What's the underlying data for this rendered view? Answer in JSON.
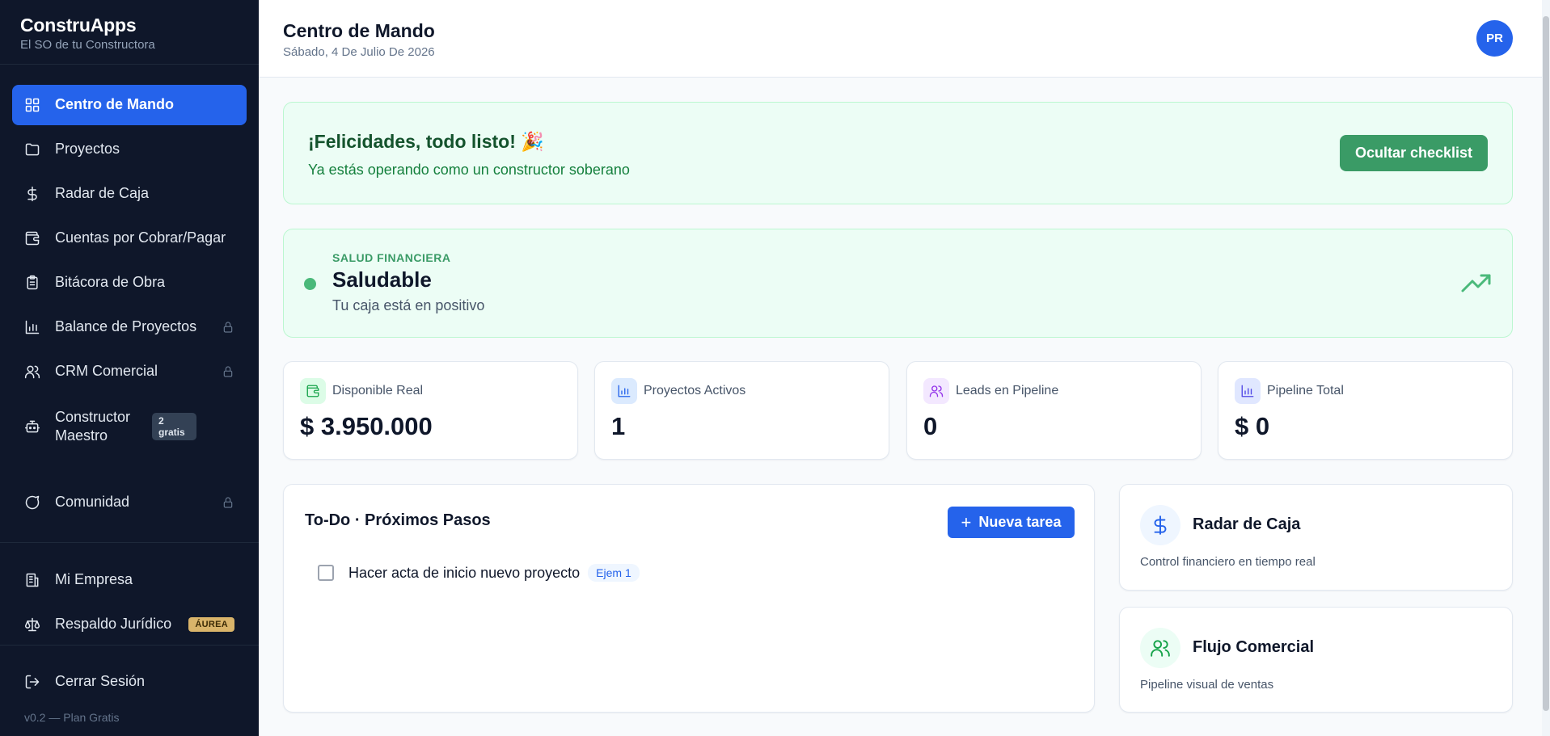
{
  "sidebar": {
    "brand": "ConstruApps",
    "tagline": "El SO de tu Constructora",
    "items": [
      {
        "label": "Centro de Mando"
      },
      {
        "label": "Proyectos"
      },
      {
        "label": "Radar de Caja"
      },
      {
        "label": "Cuentas por Cobrar/Pagar"
      },
      {
        "label": "Bitácora de Obra"
      },
      {
        "label": "Balance de Proyectos"
      },
      {
        "label": "CRM Comercial"
      },
      {
        "label": "Constructor Maestro",
        "badge": "2 gratis"
      },
      {
        "label": "Comunidad"
      },
      {
        "label": "Mi Empresa"
      },
      {
        "label": "Respaldo Jurídico",
        "badge": "ÁUREA"
      }
    ],
    "logout": "Cerrar Sesión",
    "version": "v0.2 — Plan Gratis"
  },
  "header": {
    "title": "Centro de Mando",
    "date": "Sábado, 4 De Julio De 2026",
    "avatar": "PR"
  },
  "congrats": {
    "title": "¡Felicidades, todo listo! 🎉",
    "subtitle": "Ya estás operando como un constructor soberano",
    "button": "Ocultar checklist"
  },
  "health": {
    "kicker": "SALUD FINANCIERA",
    "status": "Saludable",
    "message": "Tu caja está en positivo"
  },
  "stats": [
    {
      "label": "Disponible Real",
      "value": "$ 3.950.000"
    },
    {
      "label": "Proyectos Activos",
      "value": "1"
    },
    {
      "label": "Leads en Pipeline",
      "value": "0"
    },
    {
      "label": "Pipeline Total",
      "value": "$ 0"
    }
  ],
  "todo": {
    "title": "To-Do · Próximos Pasos",
    "button": "Nueva tarea",
    "tasks": [
      {
        "text": "Hacer acta de inicio nuevo proyecto",
        "tag": "Ejem 1"
      }
    ]
  },
  "shortcuts": [
    {
      "title": "Radar de Caja",
      "subtitle": "Control financiero en tiempo real"
    },
    {
      "title": "Flujo Comercial",
      "subtitle": "Pipeline visual de ventas"
    }
  ],
  "colors": {
    "sidebar_bg": "#0f172a",
    "accent": "#2563eb",
    "success": "#3a9b66",
    "success_bg": "#ecfdf5"
  }
}
